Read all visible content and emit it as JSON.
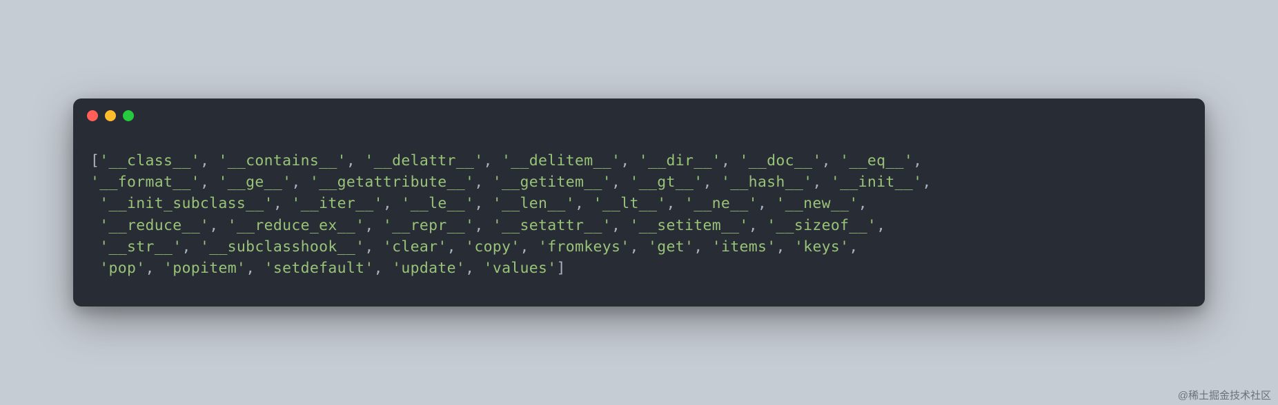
{
  "code": {
    "lines": [
      [
        {
          "t": "bracket",
          "v": "["
        },
        {
          "t": "str",
          "v": "'__class__'"
        },
        {
          "t": "comma",
          "v": ", "
        },
        {
          "t": "str",
          "v": "'__contains__'"
        },
        {
          "t": "comma",
          "v": ", "
        },
        {
          "t": "str",
          "v": "'__delattr__'"
        },
        {
          "t": "comma",
          "v": ", "
        },
        {
          "t": "str",
          "v": "'__delitem__'"
        },
        {
          "t": "comma",
          "v": ", "
        },
        {
          "t": "str",
          "v": "'__dir__'"
        },
        {
          "t": "comma",
          "v": ", "
        },
        {
          "t": "str",
          "v": "'__doc__'"
        },
        {
          "t": "comma",
          "v": ", "
        },
        {
          "t": "str",
          "v": "'__eq__'"
        },
        {
          "t": "comma",
          "v": ", "
        }
      ],
      [
        {
          "t": "str",
          "v": "'__format__'"
        },
        {
          "t": "comma",
          "v": ", "
        },
        {
          "t": "str",
          "v": "'__ge__'"
        },
        {
          "t": "comma",
          "v": ", "
        },
        {
          "t": "str",
          "v": "'__getattribute__'"
        },
        {
          "t": "comma",
          "v": ", "
        },
        {
          "t": "str",
          "v": "'__getitem__'"
        },
        {
          "t": "comma",
          "v": ", "
        },
        {
          "t": "str",
          "v": "'__gt__'"
        },
        {
          "t": "comma",
          "v": ", "
        },
        {
          "t": "str",
          "v": "'__hash__'"
        },
        {
          "t": "comma",
          "v": ", "
        },
        {
          "t": "str",
          "v": "'__init__'"
        },
        {
          "t": "comma",
          "v": ", "
        }
      ],
      [
        {
          "t": "comma",
          "v": " "
        },
        {
          "t": "str",
          "v": "'__init_subclass__'"
        },
        {
          "t": "comma",
          "v": ", "
        },
        {
          "t": "str",
          "v": "'__iter__'"
        },
        {
          "t": "comma",
          "v": ", "
        },
        {
          "t": "str",
          "v": "'__le__'"
        },
        {
          "t": "comma",
          "v": ", "
        },
        {
          "t": "str",
          "v": "'__len__'"
        },
        {
          "t": "comma",
          "v": ", "
        },
        {
          "t": "str",
          "v": "'__lt__'"
        },
        {
          "t": "comma",
          "v": ", "
        },
        {
          "t": "str",
          "v": "'__ne__'"
        },
        {
          "t": "comma",
          "v": ", "
        },
        {
          "t": "str",
          "v": "'__new__'"
        },
        {
          "t": "comma",
          "v": ", "
        }
      ],
      [
        {
          "t": "comma",
          "v": " "
        },
        {
          "t": "str",
          "v": "'__reduce__'"
        },
        {
          "t": "comma",
          "v": ", "
        },
        {
          "t": "str",
          "v": "'__reduce_ex__'"
        },
        {
          "t": "comma",
          "v": ", "
        },
        {
          "t": "str",
          "v": "'__repr__'"
        },
        {
          "t": "comma",
          "v": ", "
        },
        {
          "t": "str",
          "v": "'__setattr__'"
        },
        {
          "t": "comma",
          "v": ", "
        },
        {
          "t": "str",
          "v": "'__setitem__'"
        },
        {
          "t": "comma",
          "v": ", "
        },
        {
          "t": "str",
          "v": "'__sizeof__'"
        },
        {
          "t": "comma",
          "v": ", "
        }
      ],
      [
        {
          "t": "comma",
          "v": " "
        },
        {
          "t": "str",
          "v": "'__str__'"
        },
        {
          "t": "comma",
          "v": ", "
        },
        {
          "t": "str",
          "v": "'__subclasshook__'"
        },
        {
          "t": "comma",
          "v": ", "
        },
        {
          "t": "str",
          "v": "'clear'"
        },
        {
          "t": "comma",
          "v": ", "
        },
        {
          "t": "str",
          "v": "'copy'"
        },
        {
          "t": "comma",
          "v": ", "
        },
        {
          "t": "str",
          "v": "'fromkeys'"
        },
        {
          "t": "comma",
          "v": ", "
        },
        {
          "t": "str",
          "v": "'get'"
        },
        {
          "t": "comma",
          "v": ", "
        },
        {
          "t": "str",
          "v": "'items'"
        },
        {
          "t": "comma",
          "v": ", "
        },
        {
          "t": "str",
          "v": "'keys'"
        },
        {
          "t": "comma",
          "v": ", "
        }
      ],
      [
        {
          "t": "comma",
          "v": " "
        },
        {
          "t": "str",
          "v": "'pop'"
        },
        {
          "t": "comma",
          "v": ", "
        },
        {
          "t": "str",
          "v": "'popitem'"
        },
        {
          "t": "comma",
          "v": ", "
        },
        {
          "t": "str",
          "v": "'setdefault'"
        },
        {
          "t": "comma",
          "v": ", "
        },
        {
          "t": "str",
          "v": "'update'"
        },
        {
          "t": "comma",
          "v": ", "
        },
        {
          "t": "str",
          "v": "'values'"
        },
        {
          "t": "bracket",
          "v": "]"
        }
      ]
    ]
  },
  "watermark": "@稀土掘金技术社区"
}
